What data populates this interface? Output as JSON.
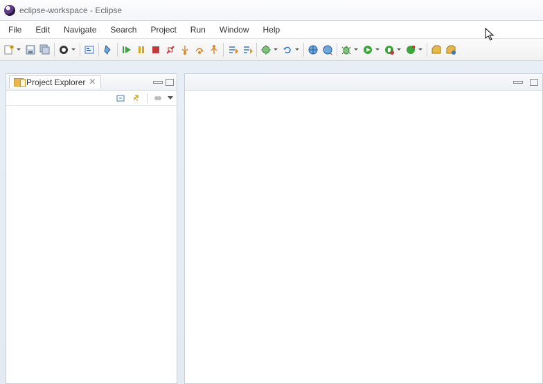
{
  "window": {
    "title": "eclipse-workspace - Eclipse"
  },
  "menubar": {
    "items": [
      "File",
      "Edit",
      "Navigate",
      "Search",
      "Project",
      "Run",
      "Window",
      "Help"
    ]
  },
  "toolbar": {
    "buttons": [
      {
        "name": "new",
        "icon": "new-icon",
        "dropdown": true
      },
      {
        "name": "save",
        "icon": "save-icon",
        "dropdown": false
      },
      {
        "name": "save-all",
        "icon": "save-all-icon",
        "dropdown": false
      },
      {
        "sep": true
      },
      {
        "name": "perspective",
        "icon": "perspective-icon",
        "dropdown": true
      },
      {
        "sep": true
      },
      {
        "name": "annotation",
        "icon": "annotation-icon",
        "dropdown": false
      },
      {
        "sep": true
      },
      {
        "name": "pin",
        "icon": "pin-icon",
        "dropdown": false
      },
      {
        "sep": true
      },
      {
        "name": "resume",
        "icon": "resume-icon",
        "dropdown": false
      },
      {
        "name": "suspend",
        "icon": "suspend-icon",
        "dropdown": false
      },
      {
        "name": "terminate",
        "icon": "terminate-icon",
        "dropdown": false
      },
      {
        "name": "disconnect",
        "icon": "disconnect-icon",
        "dropdown": false
      },
      {
        "name": "step-into",
        "icon": "step-into-icon",
        "dropdown": false
      },
      {
        "name": "step-over",
        "icon": "step-over-icon",
        "dropdown": false
      },
      {
        "name": "step-return",
        "icon": "step-return-icon",
        "dropdown": false
      },
      {
        "sep": true
      },
      {
        "name": "next-annotation",
        "icon": "next-annotation-icon",
        "dropdown": false
      },
      {
        "name": "prev-annotation",
        "icon": "prev-annotation-icon",
        "dropdown": false
      },
      {
        "sep": true
      },
      {
        "name": "debug",
        "icon": "debug-icon",
        "dropdown": true
      },
      {
        "name": "refresh",
        "icon": "refresh-icon",
        "dropdown": true
      },
      {
        "sep": true
      },
      {
        "name": "browser",
        "icon": "browser-icon",
        "dropdown": false
      },
      {
        "name": "server-profile",
        "icon": "server-profile-icon",
        "dropdown": false
      },
      {
        "sep": true
      },
      {
        "name": "debug-last",
        "icon": "debug-last-icon",
        "dropdown": true
      },
      {
        "name": "run-last",
        "icon": "run-last-icon",
        "dropdown": true
      },
      {
        "name": "coverage",
        "icon": "coverage-icon",
        "dropdown": true
      },
      {
        "name": "ext-tools",
        "icon": "ext-tools-icon",
        "dropdown": true
      },
      {
        "sep": true
      },
      {
        "name": "open-task",
        "icon": "open-task-icon",
        "dropdown": false
      },
      {
        "name": "open-type",
        "icon": "open-type-icon",
        "dropdown": false
      }
    ]
  },
  "explorer": {
    "title": "Project Explorer",
    "toolbar": {
      "collapse_all": "collapse-all-icon",
      "link_editor": "link-editor-icon",
      "focus_task": "focus-task-icon"
    }
  },
  "colors": {
    "accent_blue": "#3a76c4",
    "run_green": "#3aa53a",
    "stop_red": "#c03a3a",
    "pause_yellow": "#d6a51a",
    "step_orange": "#d6882a"
  }
}
